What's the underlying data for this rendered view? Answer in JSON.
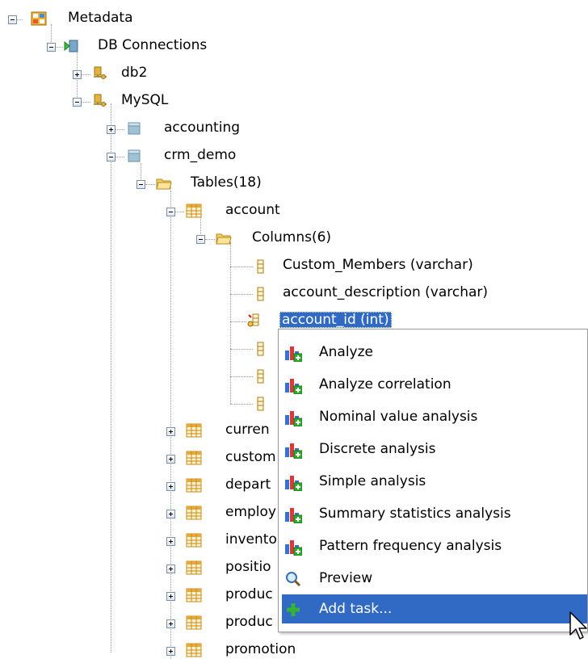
{
  "tree": {
    "metadata": "Metadata",
    "db_connections": "DB Connections",
    "db2": "db2",
    "mysql": "MySQL",
    "accounting": "accounting",
    "crm_demo": "crm_demo",
    "tables": "Tables(18)",
    "account": "account",
    "columns": "Columns(6)",
    "columns_list": [
      "Custom_Members (varchar)",
      "account_description (varchar)",
      "account_id (int)"
    ],
    "other_tables": [
      "curren",
      "custom",
      "depart",
      "employ",
      "invento",
      "positio",
      "produc",
      "produc",
      "promotion"
    ]
  },
  "context_menu": {
    "items": [
      {
        "label": "Analyze",
        "icon": "analysis-chart-icon"
      },
      {
        "label": "Analyze correlation",
        "icon": "analysis-chart-icon"
      },
      {
        "label": "Nominal value analysis",
        "icon": "analysis-chart-icon"
      },
      {
        "label": "Discrete analysis",
        "icon": "analysis-chart-icon"
      },
      {
        "label": "Simple analysis",
        "icon": "analysis-chart-icon"
      },
      {
        "label": "Summary statistics analysis",
        "icon": "analysis-chart-icon"
      },
      {
        "label": "Pattern frequency analysis",
        "icon": "analysis-chart-icon"
      },
      {
        "label": "Preview",
        "icon": "magnifier-icon"
      },
      {
        "label": "Add task...",
        "icon": "plus-icon"
      }
    ]
  },
  "colors": {
    "selection": "#316ac5",
    "menu_border": "#9a9a9a"
  }
}
